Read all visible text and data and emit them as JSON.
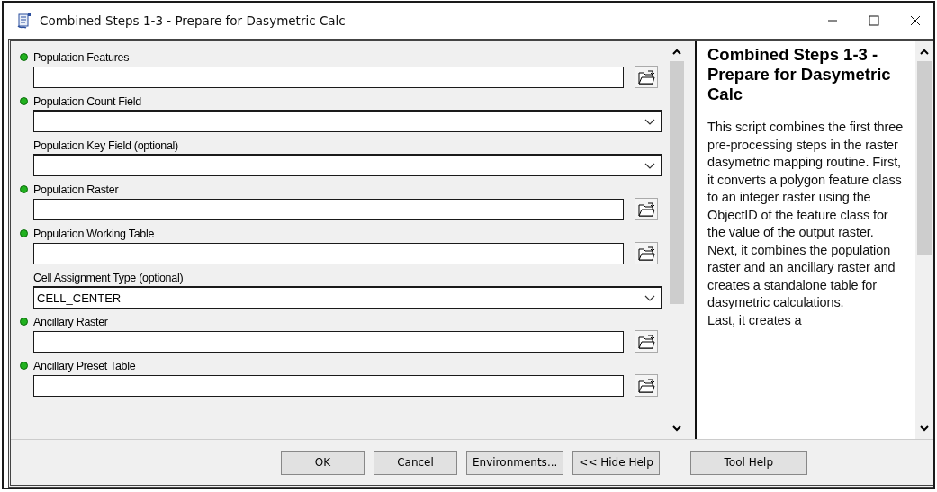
{
  "window": {
    "title": "Combined Steps 1-3 - Prepare for Dasymetric Calc"
  },
  "parameters": [
    {
      "label": "Population Features",
      "required": true,
      "kind": "file"
    },
    {
      "label": "Population Count Field",
      "required": true,
      "kind": "dropdown"
    },
    {
      "label": "Population Key Field (optional)",
      "required": false,
      "kind": "dropdown"
    },
    {
      "label": "Population Raster",
      "required": true,
      "kind": "file"
    },
    {
      "label": "Population Working Table",
      "required": true,
      "kind": "file"
    },
    {
      "label": "Cell Assignment Type (optional)",
      "required": false,
      "kind": "dropdown",
      "value": "CELL_CENTER"
    },
    {
      "label": "Ancillary Raster",
      "required": true,
      "kind": "file"
    },
    {
      "label": "Ancillary Preset Table",
      "required": true,
      "kind": "file"
    }
  ],
  "help": {
    "title": "Combined Steps 1-3 - Prepare for Dasymetric Calc",
    "text": "This script combines the first three pre-processing steps in the raster dasymetric mapping routine. First, it converts a polygon feature class to an integer raster using the ObjectID of the feature class for the value of the output raster. Next, it combines the population raster and an ancillary raster and creates a standalone table for dasymetric calculations.",
    "cut_line": "Last, it creates a"
  },
  "buttons": [
    {
      "label": "OK",
      "kind": "action"
    },
    {
      "label": "Cancel",
      "kind": "action"
    },
    {
      "label": "Environments...",
      "kind": "action"
    },
    {
      "label": "<< Hide Help",
      "kind": "action"
    },
    {
      "label": "Tool Help",
      "kind": "help"
    }
  ]
}
